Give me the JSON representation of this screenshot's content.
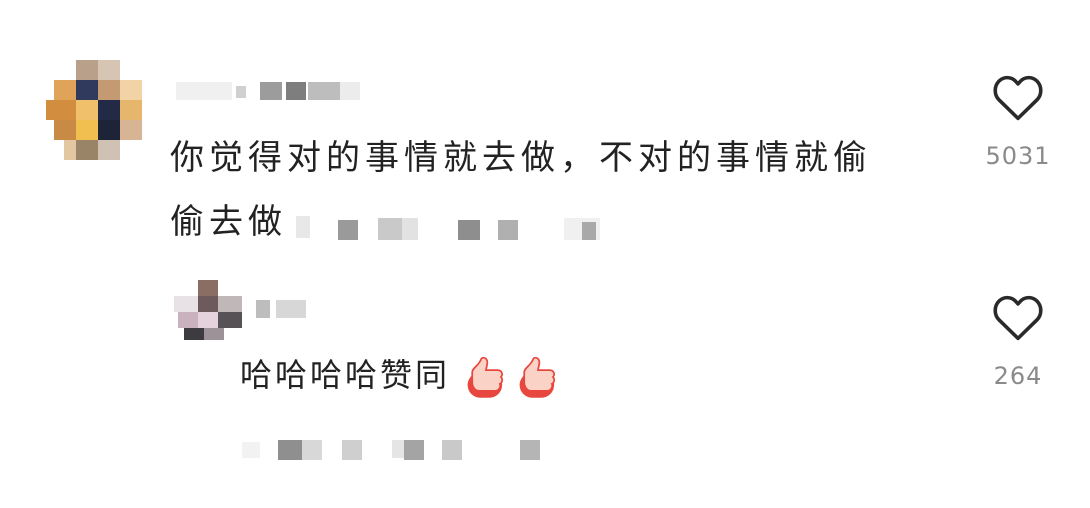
{
  "comment": {
    "text_line1": "你觉得对的事情就去做，不对的事情就偷",
    "text_line2": "偷去做",
    "like_count": "5031"
  },
  "reply": {
    "text": "哈哈哈哈赞同",
    "like_count": "264"
  },
  "icons": {
    "like": "heart-outline-icon",
    "emoji": "thumbs-up-icon"
  },
  "colors": {
    "text": "#222222",
    "count": "#8a8a8a",
    "heart_stroke": "#2a2a2a",
    "thumb": "#f04a4a"
  }
}
